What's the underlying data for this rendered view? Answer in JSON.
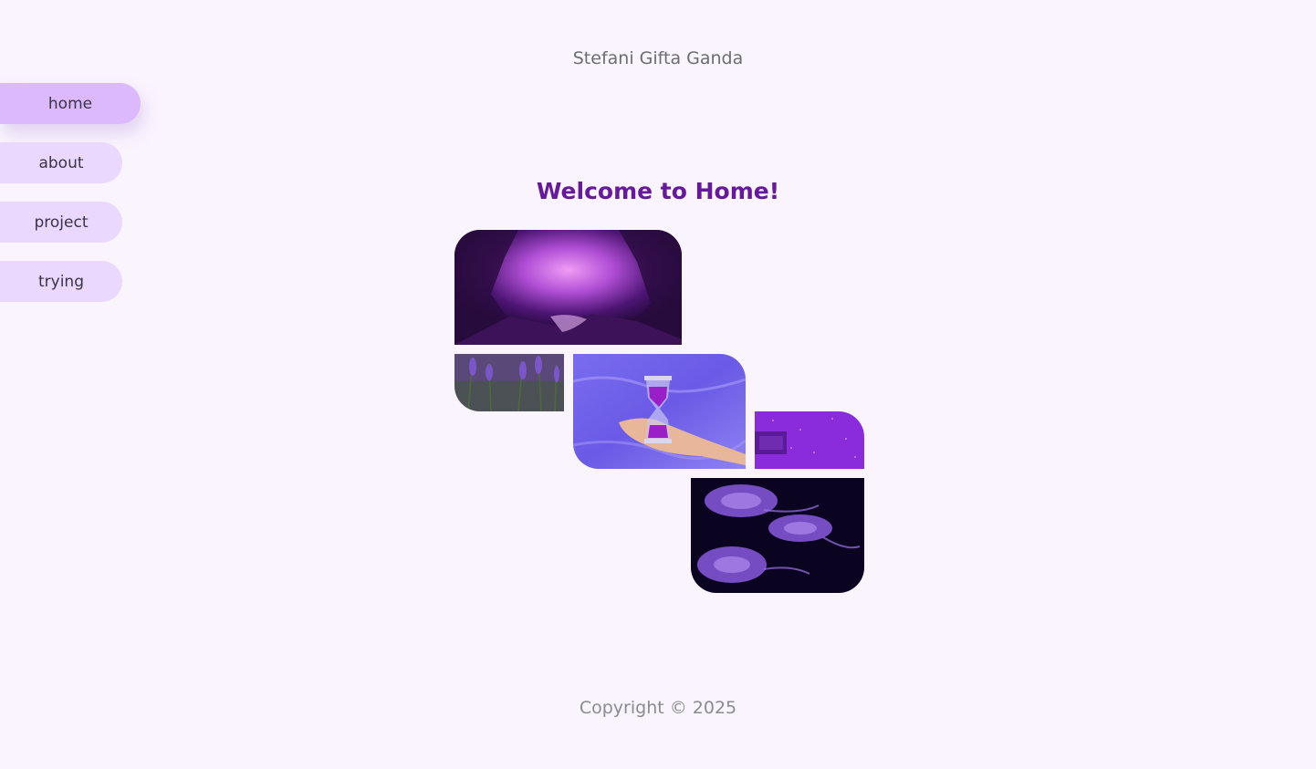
{
  "header": {
    "site_name": "Stefani Gifta Ganda"
  },
  "nav": {
    "items": [
      {
        "label": "home",
        "active": true
      },
      {
        "label": "about",
        "active": false
      },
      {
        "label": "project",
        "active": false
      },
      {
        "label": "trying",
        "active": false
      }
    ]
  },
  "main": {
    "heading": "Welcome to Home!",
    "gallery": [
      {
        "name": "purple-cave-photo"
      },
      {
        "name": "lavender-flowers-photo"
      },
      {
        "name": "hand-holding-hourglass-photo"
      },
      {
        "name": "purple-night-scene-photo"
      },
      {
        "name": "jellyfish-photo"
      }
    ]
  },
  "footer": {
    "copyright": "Copyright © 2025"
  },
  "colors": {
    "background": "#faf4fe",
    "nav_item": "#ead8fe",
    "nav_item_active": "#dcb9fd",
    "heading": "#66199a"
  }
}
